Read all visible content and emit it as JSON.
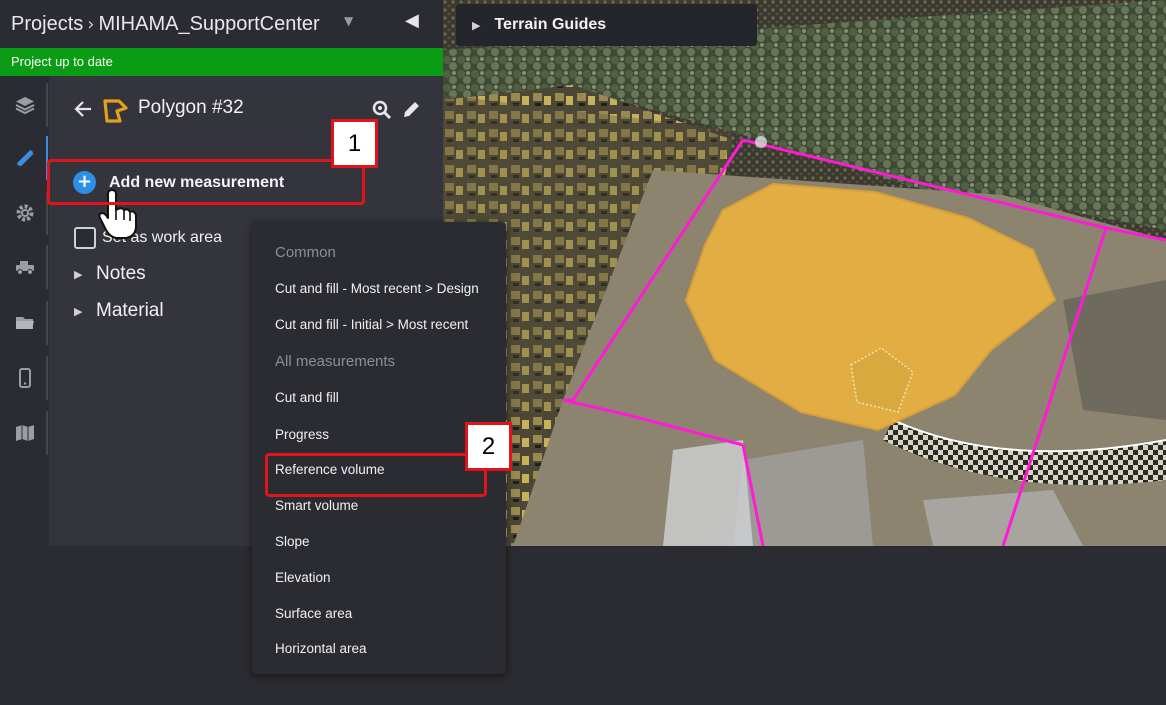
{
  "header": {
    "root": "Projects",
    "project": "MIHAMA_SupportCenter"
  },
  "status": "Project up to date",
  "rail": [
    "layers-icon",
    "measure-tools-icon",
    "settings-gear-icon",
    "vehicles-icon",
    "folder-icon",
    "mobile-device-icon",
    "map-icon"
  ],
  "panel": {
    "title": "Polygon #32",
    "add_measurement": "Add new measurement",
    "work_area_label": "Set as work area",
    "tree": [
      "Notes",
      "Material"
    ]
  },
  "terrain_guides": "Terrain Guides",
  "menu": {
    "common_heading": "Common",
    "common_items": [
      "Cut and fill - Most recent > Design",
      "Cut and fill - Initial > Most recent"
    ],
    "all_heading": "All measurements",
    "all_items": [
      "Cut and fill",
      "Progress",
      "Reference volume",
      "Smart volume",
      "Slope",
      "Elevation",
      "Surface area",
      "Horizontal area"
    ]
  },
  "callouts": [
    "1",
    "2"
  ],
  "colors": {
    "status_green": "#0a9c14",
    "accent_blue": "#2f8fe8",
    "callout_red": "#e0141a",
    "polygon_magenta": "#ff1ad6",
    "volume_yellow": "#f5b83a"
  }
}
